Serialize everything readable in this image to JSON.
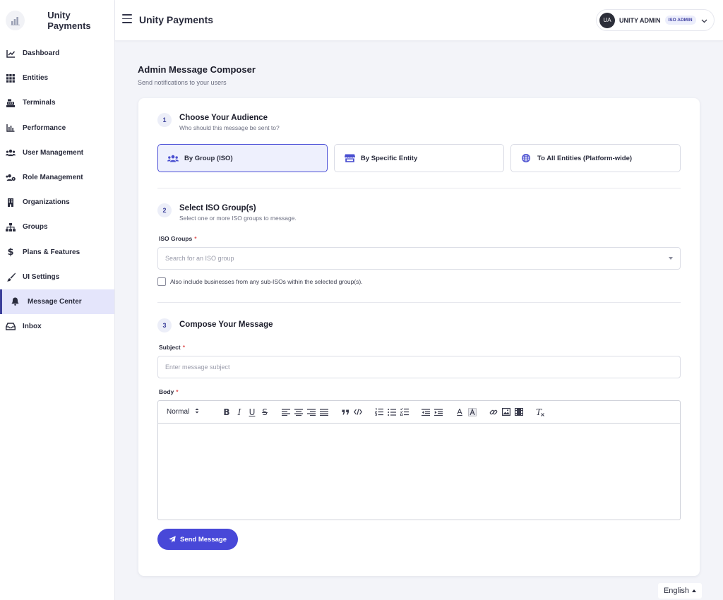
{
  "app": {
    "brand_name": "Unity Payments",
    "header_title": "Unity Payments"
  },
  "user": {
    "initials": "UA",
    "name": "UNITY ADMIN",
    "role": "ISO ADMIN"
  },
  "sidebar": {
    "items": [
      {
        "label": "Dashboard",
        "icon": "chart-line-icon",
        "active": false
      },
      {
        "label": "Entities",
        "icon": "grid-icon",
        "active": false
      },
      {
        "label": "Terminals",
        "icon": "cash-register-icon",
        "active": false
      },
      {
        "label": "Performance",
        "icon": "bar-chart-icon",
        "active": false
      },
      {
        "label": "User Management",
        "icon": "users-icon",
        "active": false
      },
      {
        "label": "Role Management",
        "icon": "users-cog-icon",
        "active": false
      },
      {
        "label": "Organizations",
        "icon": "building-icon",
        "active": false
      },
      {
        "label": "Groups",
        "icon": "sitemap-icon",
        "active": false
      },
      {
        "label": "Plans & Features",
        "icon": "dollar-icon",
        "active": false
      },
      {
        "label": "UI Settings",
        "icon": "paintbrush-icon",
        "active": false
      },
      {
        "label": "Message Center",
        "icon": "bell-icon",
        "active": true
      },
      {
        "label": "Inbox",
        "icon": "inbox-icon",
        "active": false
      }
    ]
  },
  "page": {
    "title": "Admin Message Composer",
    "subtitle": "Send notifications to your users"
  },
  "step1": {
    "number": "1",
    "title": "Choose Your Audience",
    "subtitle": "Who should this message be sent to?",
    "options": [
      {
        "label": "By Group (ISO)",
        "icon": "users-icon",
        "selected": true
      },
      {
        "label": "By Specific Entity",
        "icon": "store-icon",
        "selected": false
      },
      {
        "label": "To All Entities (Platform-wide)",
        "icon": "globe-icon",
        "selected": false
      }
    ]
  },
  "step2": {
    "number": "2",
    "title": "Select ISO Group(s)",
    "subtitle": "Select one or more ISO groups to message.",
    "field_label": "ISO Groups",
    "required_mark": "*",
    "placeholder": "Search for an ISO group",
    "checkbox_label": "Also include businesses from any sub-ISOs within the selected group(s).",
    "checkbox_checked": false
  },
  "step3": {
    "number": "3",
    "title": "Compose Your Message",
    "subject_label": "Subject",
    "subject_placeholder": "Enter message subject",
    "body_label": "Body",
    "required_mark": "*",
    "toolbar": {
      "heading_select": "Normal",
      "buttons": [
        "bold-icon",
        "italic-icon",
        "underline-icon",
        "strikethrough-icon",
        "align-left-icon",
        "align-center-icon",
        "align-right-icon",
        "align-justify-icon",
        "blockquote-icon",
        "code-icon",
        "ordered-list-icon",
        "bullet-list-icon",
        "check-list-icon",
        "outdent-icon",
        "indent-icon",
        "text-color-icon",
        "background-color-icon",
        "link-icon",
        "image-icon",
        "video-icon",
        "clear-format-icon"
      ],
      "labels": {
        "bold": "B",
        "italic": "I",
        "underline": "U",
        "strike": "S",
        "color": "A",
        "clear": "T"
      }
    },
    "body_value": ""
  },
  "actions": {
    "send_label": "Send Message"
  },
  "footer": {
    "language": "English"
  },
  "colors": {
    "accent": "#4848d8",
    "selected_bg": "#eef0fd",
    "active_nav_bg": "#e4e5fb",
    "required": "#e05353"
  }
}
